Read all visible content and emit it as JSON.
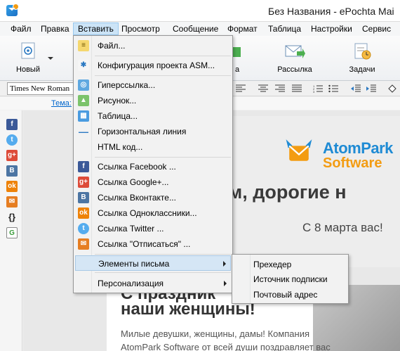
{
  "window": {
    "title": "Без Названия - ePochta Mai"
  },
  "menubar": [
    "Файл",
    "Правка",
    "Вставить",
    "Просмотр",
    "Сообщение",
    "Формат",
    "Таблица",
    "Настройки",
    "Сервис"
  ],
  "ribbon": {
    "new_label": "Новый",
    "partial_label": "а",
    "mailing_label": "Рассылка",
    "tasks_label": "Задачи"
  },
  "formatbar": {
    "font": "Times New Roman"
  },
  "subject": {
    "label": "Тема:"
  },
  "email": {
    "logo_line1": "AtomPark",
    "logo_line2": "Software",
    "heading": "ком, дорогие н",
    "subheading": "С 8 марта вас!",
    "greet_line1": "С праздник",
    "greet_line2": "наши женщины!",
    "para_line1": "Милые девушки, женщины, дамы! Компания",
    "para_line2": "AtomPark Software от всей души поздравляет вас"
  },
  "insert_menu": {
    "items": [
      {
        "label": "Файл...",
        "icon": "file-icon"
      },
      {
        "label": "Конфигурация проекта ASM...",
        "icon": "config-icon"
      },
      {
        "label": "Гиперссылка...",
        "icon": "hyperlink-icon"
      },
      {
        "label": "Рисунок...",
        "icon": "picture-icon"
      },
      {
        "label": "Таблица...",
        "icon": "table-icon"
      },
      {
        "label": "Горизонтальная линия",
        "icon": "hline-icon"
      },
      {
        "label": "HTML код...",
        "icon": ""
      },
      {
        "label": "Ссылка Facebook ...",
        "icon": "facebook-icon"
      },
      {
        "label": "Ссылка Google+...",
        "icon": "googleplus-icon"
      },
      {
        "label": "Ссылка Вконтакте...",
        "icon": "vk-icon"
      },
      {
        "label": "Ссылка Одноклассники...",
        "icon": "odnoklassniki-icon"
      },
      {
        "label": "Ссылка Twitter ...",
        "icon": "twitter-icon"
      },
      {
        "label": "Ссылка \"Отписаться\" ...",
        "icon": "unsubscribe-icon"
      },
      {
        "label": "Элементы письма",
        "icon": ""
      },
      {
        "label": "Персонализация",
        "icon": ""
      }
    ]
  },
  "letter_elements_submenu": {
    "items": [
      "Прехедер",
      "Источник подписки",
      "Почтовый адрес"
    ]
  },
  "left_icons": [
    "facebook-icon",
    "twitter-icon",
    "googleplus-icon",
    "vk-icon",
    "odnoklassniki-icon",
    "email-icon",
    "braces-icon",
    "google-icon"
  ],
  "colors": {
    "menu_highlight": "#d5e6f5",
    "brand_blue": "#1f8bd4",
    "brand_orange": "#f39c12"
  }
}
